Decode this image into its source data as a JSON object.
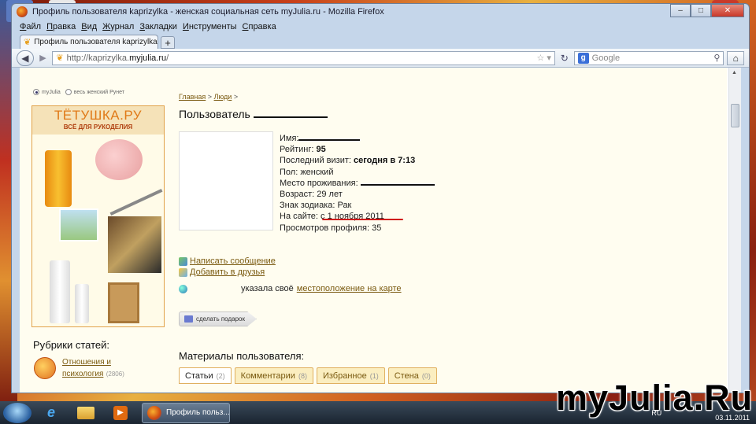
{
  "window": {
    "title": "Профиль пользователя kaprizylka - женская социальная сеть myJulia.ru - Mozilla Firefox",
    "controls": {
      "minimize": "–",
      "maximize": "□",
      "close": "✕"
    }
  },
  "menu": [
    "Файл",
    "Правка",
    "Вид",
    "Журнал",
    "Закладки",
    "Инструменты",
    "Справка"
  ],
  "tab": {
    "label": "Профиль пользователя kaprizylka - же...",
    "close": "×",
    "new_tab": "+"
  },
  "nav": {
    "back": "◀",
    "forward": "▶",
    "reload": "↻",
    "home": "⌂",
    "url_prefix": "http://kaprizylka.",
    "url_host": "myjulia.ru",
    "url_suffix": "/",
    "bookmark": "☆ ▾",
    "search_placeholder": "Google",
    "search_engine": "g",
    "search_icon": "⚲"
  },
  "sidebar": {
    "radio_mine": "myJulia",
    "radio_all": "весь женский Рунет",
    "ad_title": "ТЁТУШКА.РУ",
    "ad_subtitle": "ВСЁ ДЛЯ РУКОДЕЛИЯ",
    "rubrics_title": "Рубрики статей:",
    "rubric_line1": "Отношения и",
    "rubric_line2": "психология",
    "rubric_count": "(2806)"
  },
  "breadcrumb": {
    "home": "Главная",
    "sep": ">",
    "people": "Люди"
  },
  "profile": {
    "heading": "Пользователь",
    "name_label": "Имя:",
    "rating_label": "Рейтинг:",
    "rating_value": "95",
    "last_visit_label": "Последний визит:",
    "last_visit_value": "сегодня в 7:13",
    "gender": "Пол: женский",
    "location_label": "Место проживания:",
    "age": "Возраст: 29 лет",
    "zodiac": "Знак зодиака: Рак",
    "on_site": "На сайте: с 1 ноября 2011",
    "views": "Просмотров профиля: 35"
  },
  "actions": {
    "write_message": "Написать сообщение",
    "add_friends": "Добавить в друзья",
    "map_text": "указала своё",
    "map_link": "местоположение на карте",
    "gift": "сделать подарок"
  },
  "materials": {
    "title": "Материалы пользователя:",
    "tabs": [
      {
        "label": "Статьи",
        "count": "(2)"
      },
      {
        "label": "Комментарии",
        "count": "(8)"
      },
      {
        "label": "Избранное",
        "count": "(1)"
      },
      {
        "label": "Стена",
        "count": "(0)"
      }
    ]
  },
  "taskbar": {
    "task_label": "Профиль польз...",
    "lang": "RU",
    "time": "",
    "date": "03.11.2011"
  },
  "watermark": "myJulia.Ru",
  "colors": {
    "link": "#7a5a10",
    "accent_red": "#d01818",
    "ad_orange": "#e07a18"
  }
}
